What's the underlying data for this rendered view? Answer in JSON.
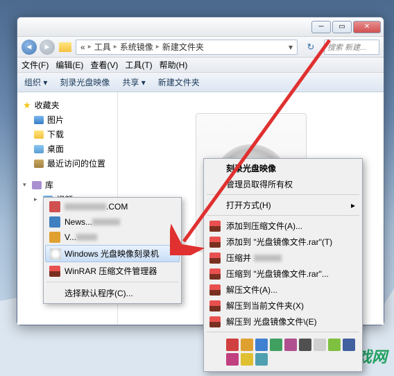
{
  "breadcrumb": {
    "sep1": "«",
    "seg1": "工具",
    "seg2": "系统镜像",
    "seg3": "新建文件夹",
    "arrow": "▸"
  },
  "search": {
    "placeholder": "搜索 新建..."
  },
  "menu": {
    "file": "文件(F)",
    "edit": "编辑(E)",
    "view": "查看(V)",
    "tools": "工具(T)",
    "help": "帮助(H)"
  },
  "toolbar": {
    "org": "组织 ▾",
    "burn": "刻录光盘映像",
    "share": "共享 ▾",
    "newfolder": "新建文件夹"
  },
  "sidebar": {
    "fav": "收藏夹",
    "items1": [
      "图片",
      "下载",
      "桌面",
      "最近访问的位置"
    ],
    "lib": "库",
    "items2": [
      "视频"
    ]
  },
  "sublist": {
    "items": [
      {
        "label": ".COM"
      },
      {
        "label": "News..."
      },
      {
        "label": "V..."
      }
    ],
    "win_burn": "Windows 光盘映像刻录机",
    "winrar": "WinRAR 压缩文件管理器",
    "default": "选择默认程序(C)..."
  },
  "ctx": {
    "burn": "刻录光盘映像",
    "admin": "管理员取得所有权",
    "openwith": "打开方式(H)",
    "addarchive": "添加到压缩文件(A)...",
    "addto": "添加到 \"光盘镜像文件.rar\"(T)",
    "compress": "压缩并",
    "compressto": "压缩到 \"光盘镜像文件.rar\"...",
    "extract": "解压文件(A)...",
    "extracthere": "解压到当前文件夹(X)",
    "extractto": "解压到 光盘镜像文件\\(E)"
  },
  "watermark": "宏昌游戏网",
  "tile_colors": [
    "#d04040",
    "#e0a030",
    "#4080d0",
    "#40a060",
    "#b05090",
    "#505050",
    "#d0d0d0",
    "#80c040",
    "#4060a0",
    "#c04080",
    "#e0c030",
    "#50a0b0"
  ]
}
